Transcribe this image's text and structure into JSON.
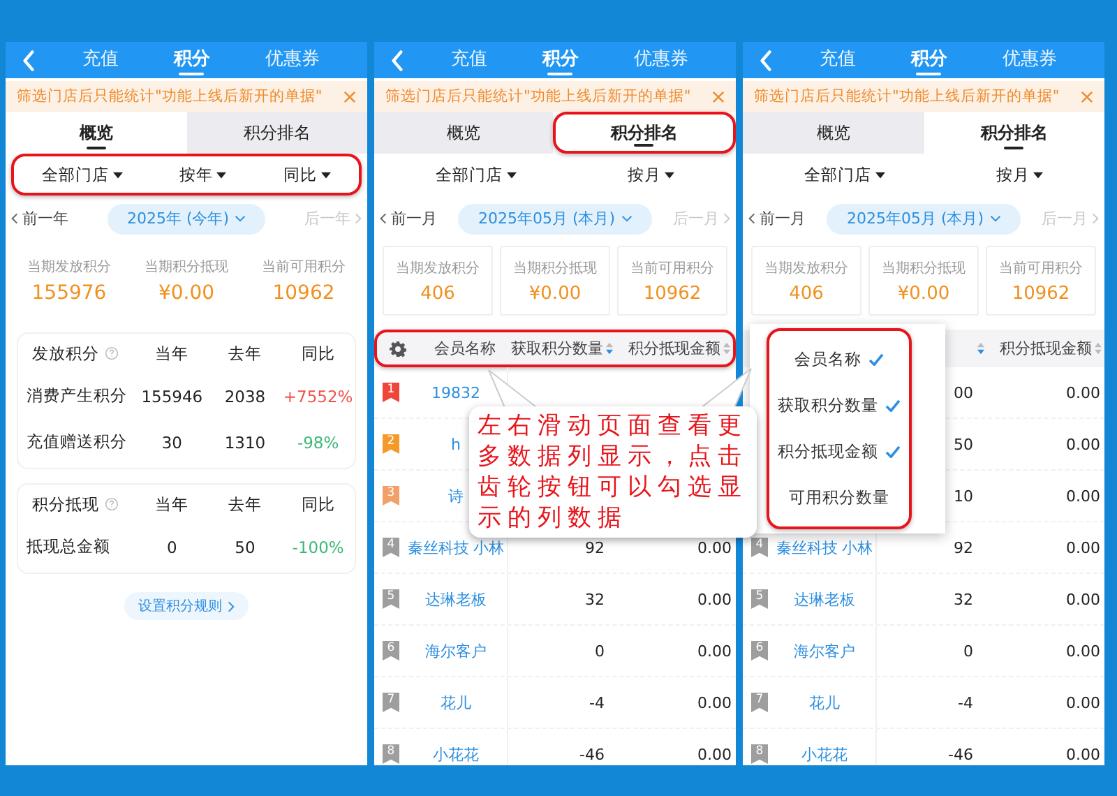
{
  "panels": [
    {
      "kind": "overview",
      "nav_tabs": [
        {
          "label": "充值",
          "selected": false
        },
        {
          "label": "积分",
          "selected": true
        },
        {
          "label": "优惠券",
          "selected": false
        }
      ],
      "notice": "筛选门店后只能统计\"功能上线后新开的单据\"",
      "view_tabs": [
        {
          "label": "概览",
          "selected": true,
          "highlighted": false
        },
        {
          "label": "积分排名",
          "selected": false,
          "highlighted": false
        }
      ],
      "filters": {
        "highlighted": true,
        "items": [
          "全部门店",
          "按年",
          "同比"
        ]
      },
      "period": {
        "prev": "前一年",
        "current": "2025年 (今年)",
        "next": "后一年",
        "next_disabled": true
      },
      "stats": [
        {
          "label": "当期发放积分",
          "value": "155976"
        },
        {
          "label": "当期积分抵现",
          "value": "¥0.00"
        },
        {
          "label": "当前可用积分",
          "value": "10962"
        }
      ],
      "tables": [
        {
          "title": "发放积分",
          "columns": [
            "当年",
            "去年",
            "同比"
          ],
          "rows": [
            {
              "label": "消费产生积分",
              "current": "155946",
              "previous": "2038",
              "change": "+7552%",
              "color": "#f0524b"
            },
            {
              "label": "充值赠送积分",
              "current": "30",
              "previous": "1310",
              "change": "-98%",
              "color": "#3cb878"
            }
          ]
        },
        {
          "title": "积分抵现",
          "columns": [
            "当年",
            "去年",
            "同比"
          ],
          "rows": [
            {
              "label": "抵现总金额",
              "current": "0",
              "previous": "50",
              "change": "-100%",
              "color": "#3cb878"
            }
          ]
        }
      ],
      "rules_button": "设置积分规则"
    },
    {
      "kind": "ranking",
      "nav_tabs": [
        {
          "label": "充值",
          "selected": false
        },
        {
          "label": "积分",
          "selected": true
        },
        {
          "label": "优惠券",
          "selected": false
        }
      ],
      "notice": "筛选门店后只能统计\"功能上线后新开的单据\"",
      "view_tabs": [
        {
          "label": "概览",
          "selected": false,
          "highlighted": false
        },
        {
          "label": "积分排名",
          "selected": true,
          "highlighted": true
        }
      ],
      "filters": {
        "highlighted": false,
        "items": [
          "全部门店",
          "按月"
        ]
      },
      "period": {
        "prev": "前一月",
        "current": "2025年05月 (本月)",
        "next": "后一月",
        "next_disabled": true
      },
      "stats": [
        {
          "label": "当期发放积分",
          "value": "406"
        },
        {
          "label": "当期积分抵现",
          "value": "¥0.00"
        },
        {
          "label": "当前可用积分",
          "value": "10962"
        }
      ],
      "ranking": {
        "highlighted": true,
        "columns": [
          {
            "label": "会员名称"
          },
          {
            "label": "获取积分数量",
            "sorted": true
          },
          {
            "label": "积分抵现金额",
            "sorted": false
          }
        ],
        "rows": [
          {
            "rank": "1",
            "color": "#f0453a",
            "name": "19832"
          },
          {
            "rank": "2",
            "color": "#f39a2b",
            "name": "h"
          },
          {
            "rank": "3",
            "color": "#f2a06a",
            "name": "诗"
          },
          {
            "rank": "4",
            "color": "#9e9e9e",
            "name": "秦丝科技 小林",
            "points": "92",
            "amount": "0.00"
          },
          {
            "rank": "5",
            "color": "#9e9e9e",
            "name": "达琳老板",
            "points": "32",
            "amount": "0.00"
          },
          {
            "rank": "6",
            "color": "#9e9e9e",
            "name": "海尔客户",
            "points": "0",
            "amount": "0.00"
          },
          {
            "rank": "7",
            "color": "#9e9e9e",
            "name": "花儿",
            "points": "-4",
            "amount": "0.00"
          },
          {
            "rank": "8",
            "color": "#9e9e9e",
            "name": "小花花",
            "points": "-46",
            "amount": "0.00"
          }
        ]
      }
    },
    {
      "kind": "ranking",
      "nav_tabs": [
        {
          "label": "充值",
          "selected": false
        },
        {
          "label": "积分",
          "selected": true
        },
        {
          "label": "优惠券",
          "selected": false
        }
      ],
      "notice": "筛选门店后只能统计\"功能上线后新开的单据\"",
      "view_tabs": [
        {
          "label": "概览",
          "selected": false,
          "highlighted": false
        },
        {
          "label": "积分排名",
          "selected": true,
          "highlighted": false
        }
      ],
      "filters": {
        "highlighted": false,
        "items": [
          "全部门店",
          "按月"
        ]
      },
      "period": {
        "prev": "前一月",
        "current": "2025年05月 (本月)",
        "next": "后一月",
        "next_disabled": true
      },
      "stats": [
        {
          "label": "当期发放积分",
          "value": "406"
        },
        {
          "label": "当期积分抵现",
          "value": "¥0.00"
        },
        {
          "label": "当前可用积分",
          "value": "10962"
        }
      ],
      "ranking": {
        "highlighted": false,
        "columns": [
          {},
          {
            "sorted": true
          },
          {
            "label": "积分抵现金额",
            "sorted": false
          }
        ],
        "rows": [
          {
            "points": "00",
            "amount": "0.00"
          },
          {
            "points": "50",
            "amount": "0.00"
          },
          {
            "points": "10",
            "amount": "0.00"
          },
          {
            "rank": "4",
            "color": "#9e9e9e",
            "name": "秦丝科技 小林",
            "points": "92",
            "amount": "0.00"
          },
          {
            "rank": "5",
            "color": "#9e9e9e",
            "name": "达琳老板",
            "points": "32",
            "amount": "0.00"
          },
          {
            "rank": "6",
            "color": "#9e9e9e",
            "name": "海尔客户",
            "points": "0",
            "amount": "0.00"
          },
          {
            "rank": "7",
            "color": "#9e9e9e",
            "name": "花儿",
            "points": "-4",
            "amount": "0.00"
          },
          {
            "rank": "8",
            "color": "#9e9e9e",
            "name": "小花花",
            "points": "-46",
            "amount": "0.00"
          }
        ]
      },
      "column_menu": {
        "highlighted": true,
        "items": [
          {
            "label": "会员名称",
            "checked": true
          },
          {
            "label": "获取积分数量",
            "checked": true
          },
          {
            "label": "积分抵现金额",
            "checked": true
          },
          {
            "label": "可用积分数量",
            "checked": false
          }
        ]
      }
    }
  ],
  "callout": {
    "text": "左右滑动页面查看更多数据列显示，点击齿轮按钮可以勾选显示的列数据"
  }
}
